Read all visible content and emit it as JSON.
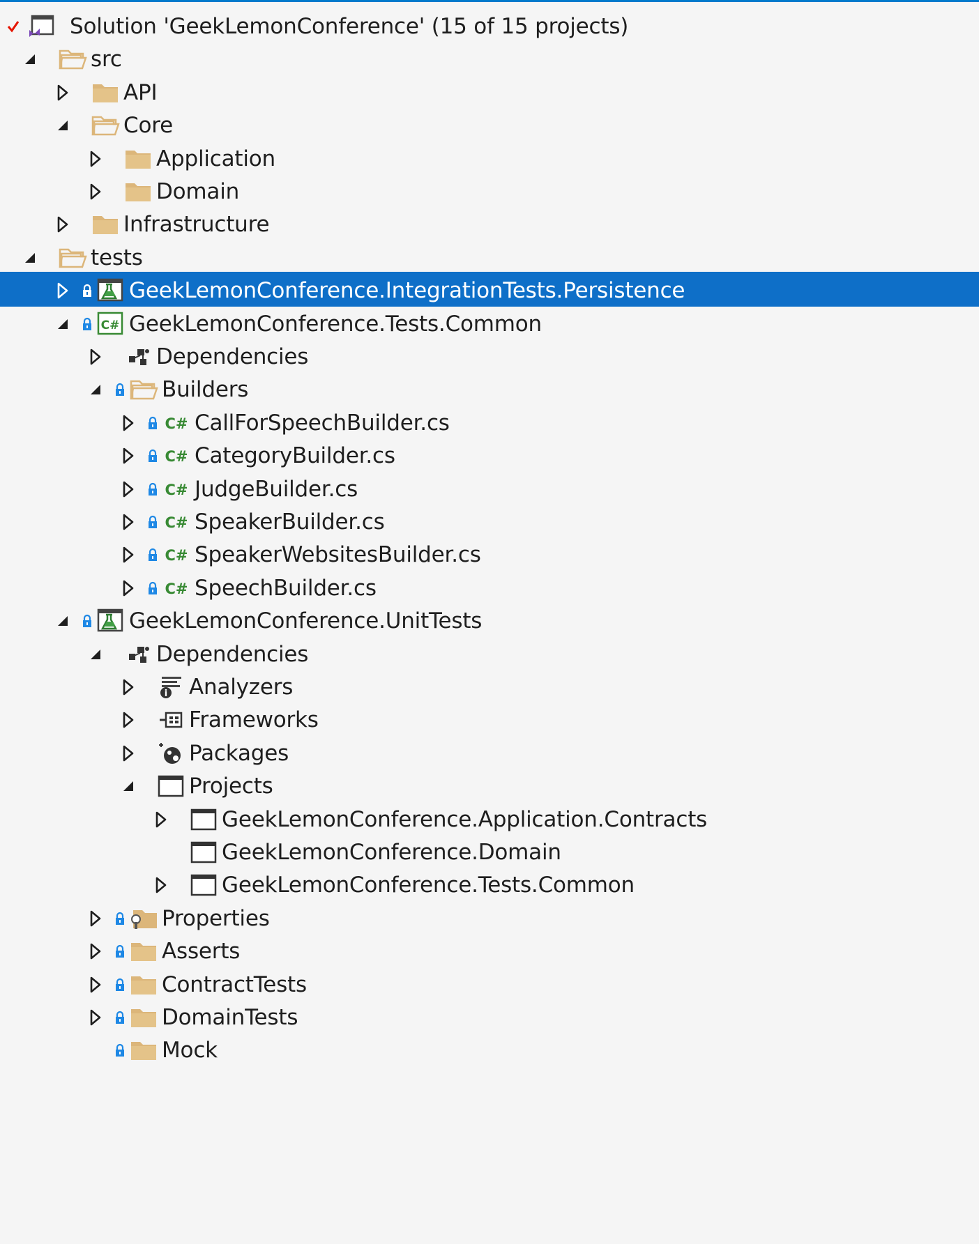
{
  "solution_explorer": {
    "rows": [
      {
        "level": 0,
        "expander": "none",
        "lock": false,
        "icon": "solution-icon",
        "label": "Solution 'GeekLemonConference' (15 of 15 projects)",
        "checked": true
      },
      {
        "level": 1,
        "expander": "expanded",
        "lock": false,
        "icon": "folder-open-icon",
        "label": "src"
      },
      {
        "level": 2,
        "expander": "collapsed",
        "lock": false,
        "icon": "folder-icon",
        "label": "API"
      },
      {
        "level": 2,
        "expander": "expanded",
        "lock": false,
        "icon": "folder-open-icon",
        "label": "Core"
      },
      {
        "level": 3,
        "expander": "collapsed",
        "lock": false,
        "icon": "folder-icon",
        "label": "Application"
      },
      {
        "level": 3,
        "expander": "collapsed",
        "lock": false,
        "icon": "folder-icon",
        "label": "Domain"
      },
      {
        "level": 2,
        "expander": "collapsed",
        "lock": false,
        "icon": "folder-icon",
        "label": "Infrastructure"
      },
      {
        "level": 1,
        "expander": "expanded",
        "lock": false,
        "icon": "folder-open-icon",
        "label": "tests"
      },
      {
        "level": 2,
        "expander": "collapsed",
        "lock": true,
        "icon": "test-project-icon",
        "label": "GeekLemonConference.IntegrationTests.Persistence",
        "selected": true
      },
      {
        "level": 2,
        "expander": "expanded",
        "lock": true,
        "icon": "csharp-project-icon",
        "label": "GeekLemonConference.Tests.Common"
      },
      {
        "level": 3,
        "expander": "collapsed",
        "lock": false,
        "icon": "dependencies-icon",
        "label": "Dependencies"
      },
      {
        "level": 3,
        "expander": "expanded",
        "lock": true,
        "icon": "folder-open-icon",
        "label": "Builders"
      },
      {
        "level": 4,
        "expander": "collapsed",
        "lock": true,
        "icon": "csharp-file-icon",
        "label": "CallForSpeechBuilder.cs"
      },
      {
        "level": 4,
        "expander": "collapsed",
        "lock": true,
        "icon": "csharp-file-icon",
        "label": "CategoryBuilder.cs"
      },
      {
        "level": 4,
        "expander": "collapsed",
        "lock": true,
        "icon": "csharp-file-icon",
        "label": "JudgeBuilder.cs"
      },
      {
        "level": 4,
        "expander": "collapsed",
        "lock": true,
        "icon": "csharp-file-icon",
        "label": "SpeakerBuilder.cs"
      },
      {
        "level": 4,
        "expander": "collapsed",
        "lock": true,
        "icon": "csharp-file-icon",
        "label": "SpeakerWebsitesBuilder.cs"
      },
      {
        "level": 4,
        "expander": "collapsed",
        "lock": true,
        "icon": "csharp-file-icon",
        "label": "SpeechBuilder.cs"
      },
      {
        "level": 2,
        "expander": "expanded",
        "lock": true,
        "icon": "test-project-icon",
        "label": "GeekLemonConference.UnitTests"
      },
      {
        "level": 3,
        "expander": "expanded",
        "lock": false,
        "icon": "dependencies-icon",
        "label": "Dependencies"
      },
      {
        "level": 4,
        "expander": "collapsed",
        "lock": false,
        "icon": "analyzers-icon",
        "label": "Analyzers"
      },
      {
        "level": 4,
        "expander": "collapsed",
        "lock": false,
        "icon": "frameworks-icon",
        "label": "Frameworks"
      },
      {
        "level": 4,
        "expander": "collapsed",
        "lock": false,
        "icon": "packages-icon",
        "label": "Packages"
      },
      {
        "level": 4,
        "expander": "expanded",
        "lock": false,
        "icon": "projects-icon",
        "label": "Projects"
      },
      {
        "level": 5,
        "expander": "collapsed",
        "lock": false,
        "icon": "project-reference-icon",
        "label": "GeekLemonConference.Application.Contracts"
      },
      {
        "level": 5,
        "expander": "none",
        "lock": false,
        "icon": "project-reference-icon",
        "label": "GeekLemonConference.Domain"
      },
      {
        "level": 5,
        "expander": "collapsed",
        "lock": false,
        "icon": "project-reference-icon",
        "label": "GeekLemonConference.Tests.Common"
      },
      {
        "level": 3,
        "expander": "collapsed",
        "lock": true,
        "icon": "properties-folder-icon",
        "label": "Properties"
      },
      {
        "level": 3,
        "expander": "collapsed",
        "lock": true,
        "icon": "folder-icon",
        "label": "Asserts"
      },
      {
        "level": 3,
        "expander": "collapsed",
        "lock": true,
        "icon": "folder-icon",
        "label": "ContractTests"
      },
      {
        "level": 3,
        "expander": "collapsed",
        "lock": true,
        "icon": "folder-icon",
        "label": "DomainTests"
      },
      {
        "level": 3,
        "expander": "none",
        "lock": true,
        "icon": "folder-icon",
        "label": "Mock"
      }
    ]
  },
  "colors": {
    "background": "#f5f5f5",
    "selection": "#0e6fc8",
    "folder": "#dcb67a",
    "lock": "#1e88e5",
    "csharp": "#388a34",
    "text": "#1e1e1e",
    "check": "#e51400"
  }
}
